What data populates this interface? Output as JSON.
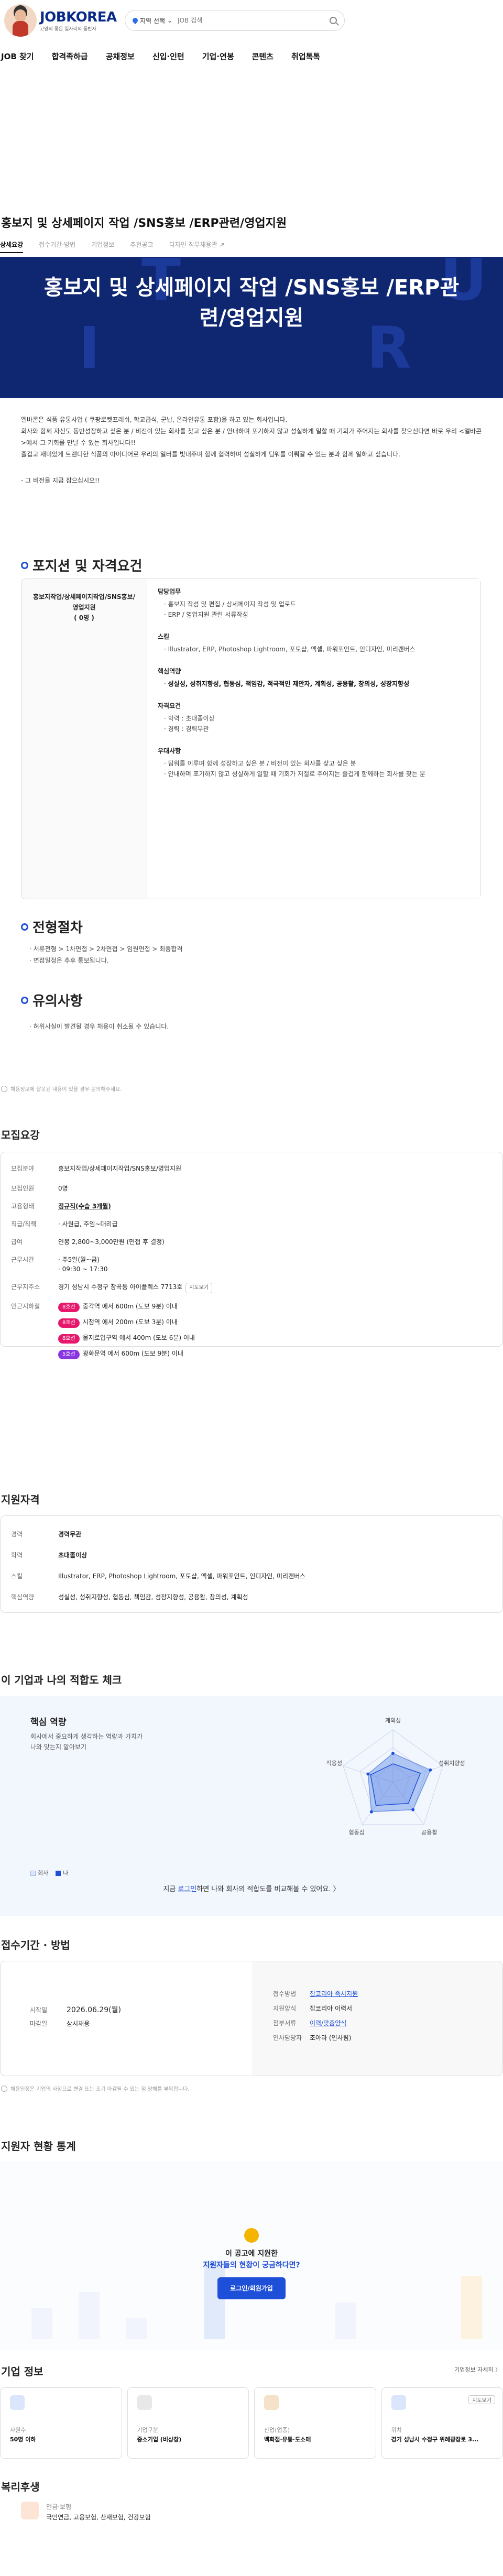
{
  "header": {
    "logo_name": "JOBKOREA",
    "logo_sub": "고양의 좋은 일자리의 동반자",
    "location_label": "지역 선택",
    "search_placeholder": "JOB 검색"
  },
  "gnb": [
    "JOB 찾기",
    "합격족하급",
    "공채정보",
    "신입·인턴",
    "기업·연봉",
    "콘텐츠",
    "취업톡톡"
  ],
  "job": {
    "title": "홍보지 및 상세페이지 작업 /SNS홍보 /ERP관련/영업지원",
    "tabs": [
      "상세요강",
      "접수기간·방법",
      "기업정보",
      "추천공고",
      "디자인 직무채용관 ↗"
    ],
    "hero_title": "홍보지 및 상세페이지 작업 /SNS홍보 /ERP관련/영업지원"
  },
  "intro": {
    "lines": [
      "엘바콘은 식품 유통사업 ( 쿠팡로켓프레쉬, 학교급식, 군납, 온라인유통 포함)을 하고 있는 회사입니다.",
      "회사와 함께 자신도 동반성장하고 싶은 분 / 비전이 있는 회사를 찾고 싶은 분 / 안내하며 포기하지 않고 성실하게 일할 때 기회가 주어지는 회사를 찾으신다면 바로 우리 <엘바콘>에서 그 기회를 만날 수 있는 회사입니다!!",
      "즐겁고 재미있게 트렌디한 식품의 아이디어로 우리의 일터를 빛내주며 함께 협력하며 성실하게 팀워를 이뤄갈 수 있는 분과 함께 일하고 싶습니다."
    ],
    "quote": "- 그 비전을 지금 잡으십시오!!"
  },
  "position": {
    "heading": "포지션 및 자격요건",
    "left_title": "홍보지작업/상세페이지작업/SNS홍보/영업지원",
    "left_count": "( 0명 )",
    "blocks": [
      {
        "label": "담당업무",
        "items": [
          "홍보지 작성 및 편집 / 상세페이지 작성 및 업로드",
          "ERP / 영업지원 관련 서류작성"
        ]
      },
      {
        "label": "스킬",
        "items": [
          "Illustrator, ERP, Photoshop Lightroom, 포토샵, 엑셀, 파워포인트, 인디자인, 미리캔버스"
        ]
      },
      {
        "label": "핵심역량",
        "items": [
          "성실성, 성취지향성, 협동심, 책임감, 적극적인 제안자, 계획성, 공용활, 창의성, 성장지향성"
        ]
      },
      {
        "label": "자격요건",
        "items": [
          "학력 : 초대졸이상",
          "경력 : 경력무관"
        ]
      },
      {
        "label": "우대사항",
        "items": [
          "팀워를 이루며 함께 성장하고 싶은 분 / 비전이 있는 회사를 찾고 싶은 분",
          "안내하며 포기하지 않고 성실하게 일할 때 기회가 저절로 주어지는 즐겁게 함께하는 회사를 찾는 분"
        ]
      }
    ]
  },
  "process": {
    "heading": "전형절차",
    "items": [
      "서류전형 > 1차면접 > 2차면접 > 임원면접 > 최종합격",
      "면접일정은 추후 통보됩니다."
    ]
  },
  "caution": {
    "heading": "유의사항",
    "items": [
      "허위사실이 발견될 경우 채용이 취소될 수 있습니다."
    ]
  },
  "notice1": "채용정보에 잘못된 내용이 있을 경우 문의해주세요.",
  "summary": {
    "heading": "모집요강",
    "rows": [
      {
        "k": "모집분야",
        "v": "홍보지작업/상세페이지작업/SNS홍보/영업지원"
      },
      {
        "k": "모집인원",
        "v": "0명"
      },
      {
        "k": "고용형태",
        "v": "정규직(수습 3개월)"
      },
      {
        "k": "직급/직책",
        "v": "· 사원급, 주임~대리급"
      },
      {
        "k": "급여",
        "v": "연봉 2,800~3,000만원 (면접 후 결정)"
      },
      {
        "k": "근무시간",
        "v": "· 주5일(월~금)"
      },
      {
        "k": "",
        "v": "· 09:30 ~ 17:30"
      },
      {
        "k": "근무지주소",
        "v": "경기 성남시 수정구 창곡동 아이플렉스 7713호"
      },
      {
        "k": "인근지하철",
        "v": ""
      }
    ],
    "map_button": "지도보기",
    "subway": [
      {
        "line": "8호선",
        "color": "#e6186c",
        "text": "중각역 에서 600m (도보 9분) 이내"
      },
      {
        "line": "8호선",
        "color": "#e6186c",
        "text": "시청역 에서 200m (도보 3분) 이내"
      },
      {
        "line": "8호선",
        "color": "#e6186c",
        "text": "물지로입구역 에서 400m (도보 6분) 이내"
      },
      {
        "line": "5호선",
        "color": "#8936e0",
        "text": "광화문역 에서 600m (도보 9분) 이내"
      }
    ]
  },
  "qualification": {
    "heading": "지원자격",
    "rows": [
      {
        "k": "경력",
        "v": "경력무관"
      },
      {
        "k": "학력",
        "v": "초대졸이상"
      },
      {
        "k": "스킬",
        "v": "Illustrator, ERP, Photoshop Lightroom, 포토샵, 엑셀, 파워포인트, 인디자인, 미리캔버스"
      },
      {
        "k": "핵심역량",
        "v": "성실성, 성취지향성, 협동심, 책임감, 성장지향성, 공용활, 창의성, 계획성"
      }
    ]
  },
  "fit": {
    "heading": "이 기업과 나의 적합도 체크",
    "sub_heading": "핵심 역량",
    "desc": [
      "회사에서 중요하게 생각하는 역량과 가치가",
      "나와 맞는지 알아보기"
    ],
    "axes": [
      "계획성",
      "성취지향성",
      "공용활",
      "협동심",
      "적응성"
    ],
    "company_values": [
      0.55,
      0.75,
      0.65,
      0.7,
      0.5
    ],
    "my_values": [
      0.35,
      0.55,
      0.5,
      0.55,
      0.45
    ],
    "legend_company": "회사",
    "legend_me": "나",
    "cta_prefix": "지금 ",
    "cta_link": "로그인",
    "cta_suffix": "하면 나와 회사의 적합도를 비교해볼 수 있어요. 〉"
  },
  "apply": {
    "heading": "접수기간 · 방법",
    "left": [
      {
        "k": "시작일",
        "v": "2026.06.29(월)"
      },
      {
        "k": "마감일",
        "v": "상시채용"
      }
    ],
    "right": [
      {
        "k": "접수방법",
        "v": "잡코리아 즉시지원"
      },
      {
        "k": "지원양식",
        "v": "잡코리아 이력서"
      },
      {
        "k": "첨부서류",
        "v": "이력/맞춤양식"
      },
      {
        "k": "인사담당자",
        "v": "조아라 (인사팀)"
      }
    ],
    "notice": "채용일정은 기업의 사정으로 변경 또는 조기 마감될 수 있는 점 양해를 부탁합니다."
  },
  "stats": {
    "heading": "지원자 현황 통계",
    "center_line1": "이 공고에 지원한",
    "center_line2": "지원자들의 현황이 궁금하다면?",
    "button": "로그인/회원가입"
  },
  "company": {
    "heading": "기업 정보",
    "more": "기업정보 자세히 〉",
    "cards": [
      {
        "label": "사원수",
        "value": "50명 이하",
        "color": "#dbe6fd"
      },
      {
        "label": "기업구분",
        "value": "중소기업 (비상장)",
        "color": "#e8e8e8"
      },
      {
        "label": "산업(업종)",
        "value": "백화점·유통·도소매",
        "color": "#f6e1c9"
      },
      {
        "label": "위치",
        "value": "경기 성남시 수정구 위례광장로 3...",
        "color": "#dbe6fd",
        "btn": "지도보기"
      }
    ]
  },
  "welfare": {
    "heading": "복리후생",
    "label": "연금·보험",
    "value": "국민연금, 고용보험, 산재보험, 건강보험"
  }
}
